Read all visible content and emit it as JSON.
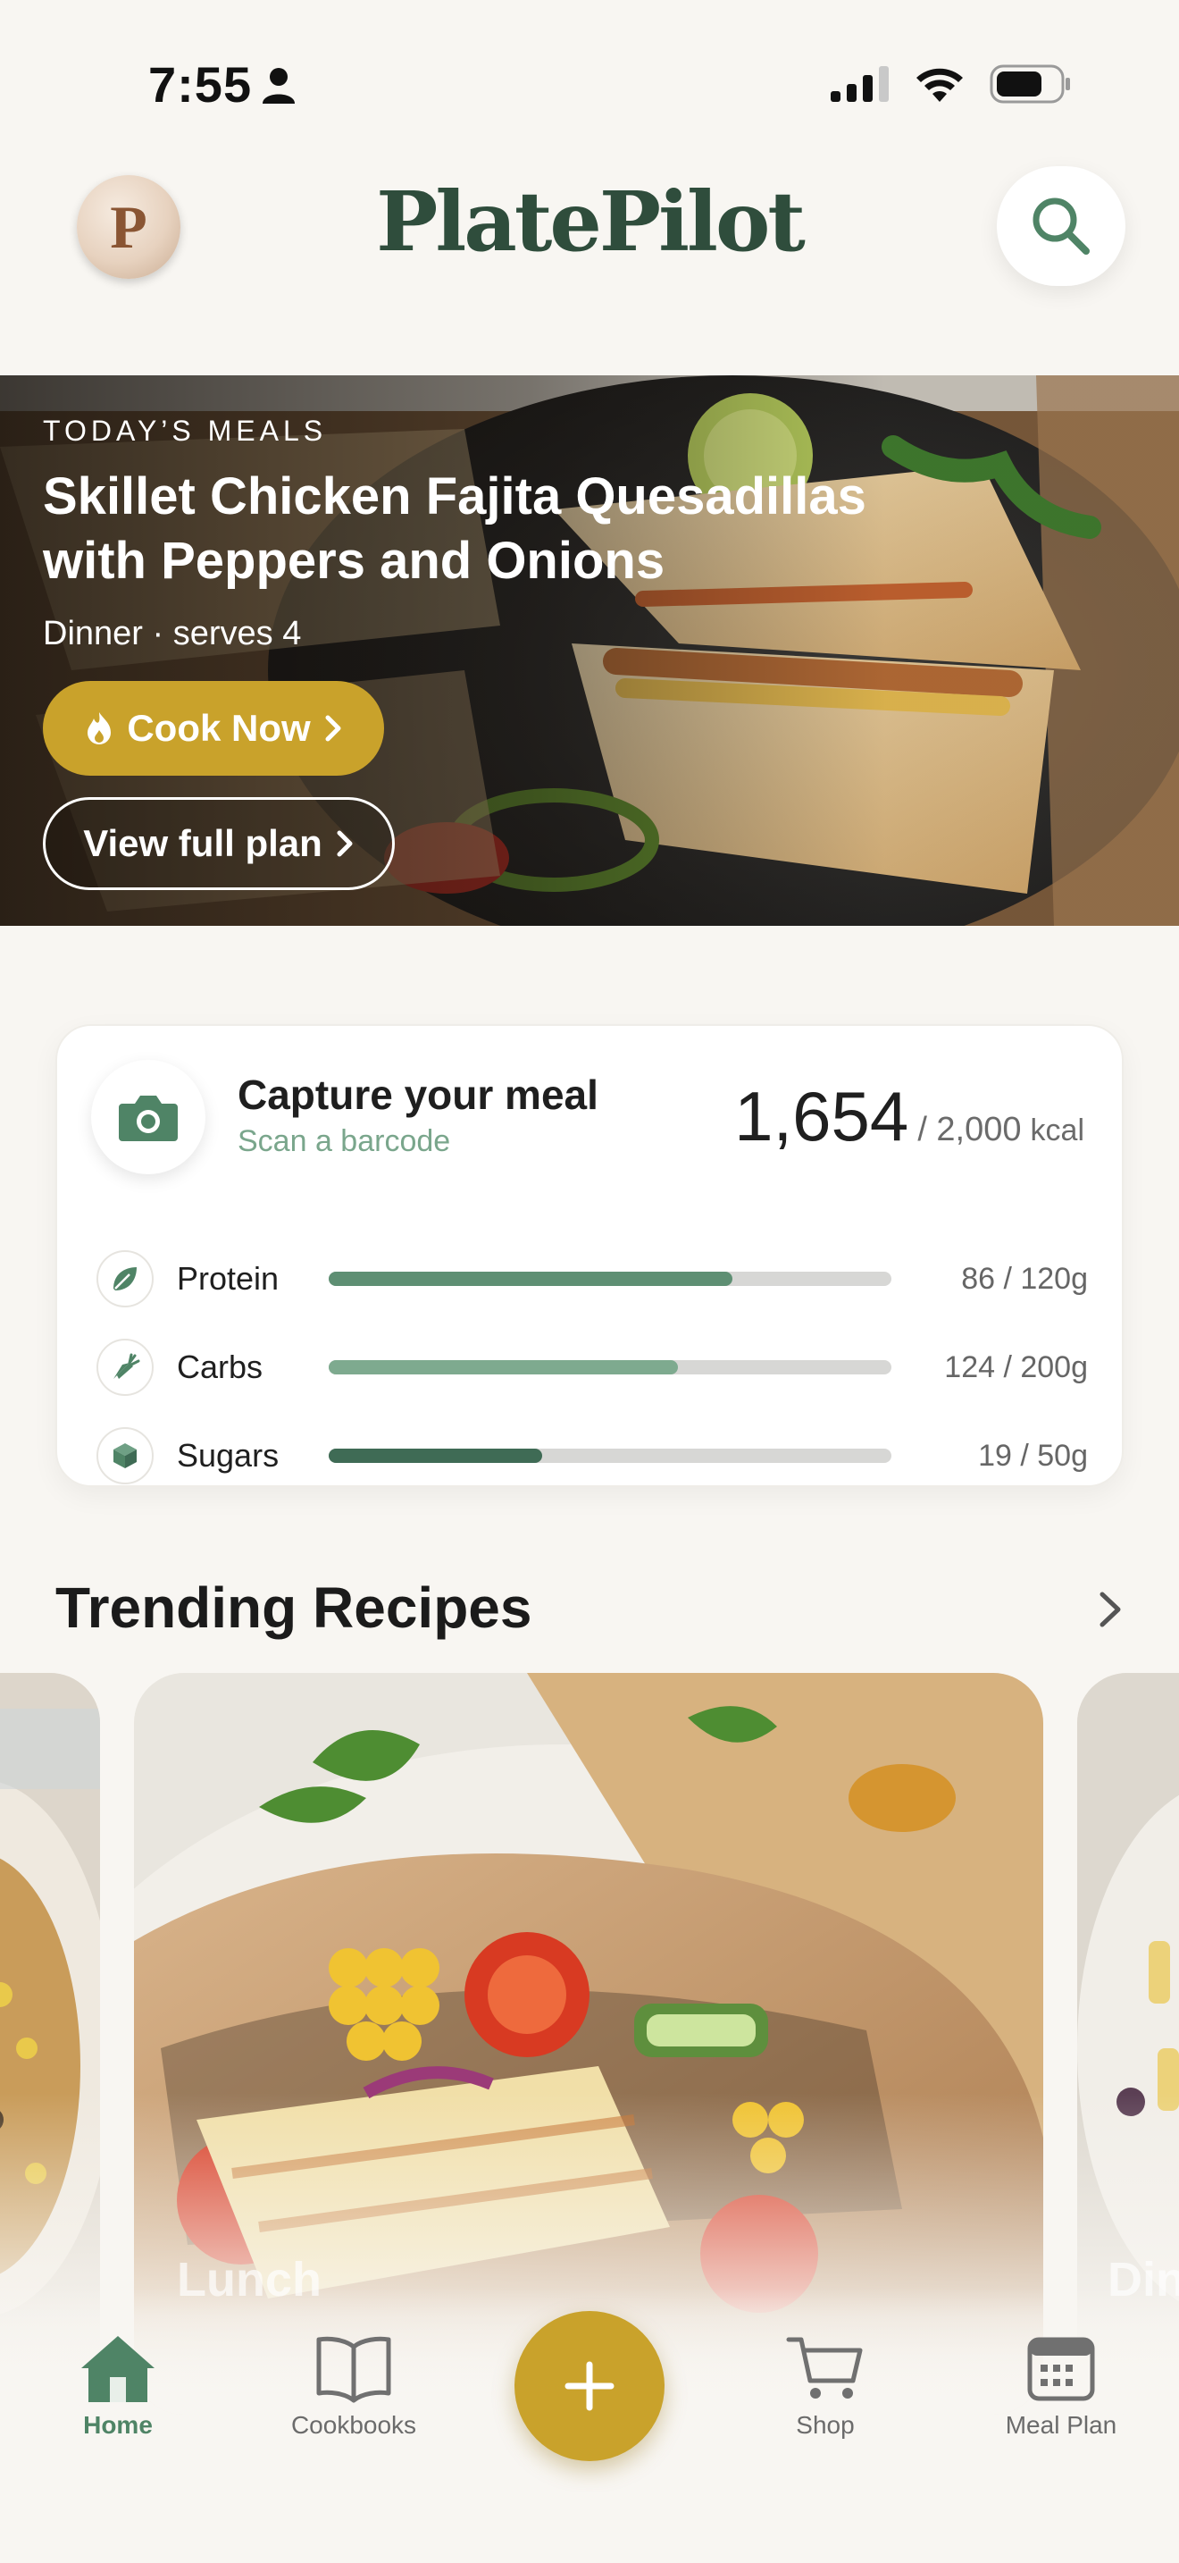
{
  "status_bar": {
    "time": "7:55"
  },
  "header": {
    "brand_title": "PlatePilot",
    "avatar_letter": "P"
  },
  "hero": {
    "eyebrow": "TODAY’S MEALS",
    "title": "Skillet Chicken Fajita Quesadillas with Peppers and Onions",
    "meta": "Dinner · serves 4",
    "cook_now_label": "Cook Now",
    "view_plan_label": "View full plan"
  },
  "nutrition": {
    "capture_title": "Capture your meal",
    "capture_subtitle": "Scan a barcode",
    "kcal_current": "1,654",
    "kcal_goal": "/ 2,000",
    "kcal_unit": "kcal",
    "macros": [
      {
        "label": "Protein",
        "value": "86 / 120g",
        "progress": 0.717,
        "color": "#5e8f73",
        "icon": "leaf-icon"
      },
      {
        "label": "Carbs",
        "value": "124 / 200g",
        "progress": 0.62,
        "color": "#7eaa8f",
        "icon": "carrot-icon"
      },
      {
        "label": "Sugars",
        "value": "19 / 50g",
        "progress": 0.38,
        "color": "#3f6b55",
        "icon": "cube-icon"
      }
    ]
  },
  "trending": {
    "title": "Trending Recipes",
    "cards": [
      {
        "label": "",
        "image": "grilled-tortilla-photo"
      },
      {
        "label": "Lunch",
        "image": "halloumi-pita-photo"
      },
      {
        "label": "Din",
        "image": "pasta-salad-photo"
      }
    ]
  },
  "bottom_nav": {
    "items": [
      {
        "label": "Home",
        "icon": "home-icon",
        "active": true
      },
      {
        "label": "Cookbooks",
        "icon": "book-icon",
        "active": false
      },
      {
        "label": "Shop",
        "icon": "cart-icon",
        "active": false
      },
      {
        "label": "Meal Plan",
        "icon": "calendar-icon",
        "active": false
      }
    ],
    "add_icon": "plus-icon"
  },
  "colors": {
    "accent_gold": "#c9a22b",
    "brand_green": "#2f4d3c",
    "active_green": "#4f8466",
    "background": "#f8f6f2"
  }
}
